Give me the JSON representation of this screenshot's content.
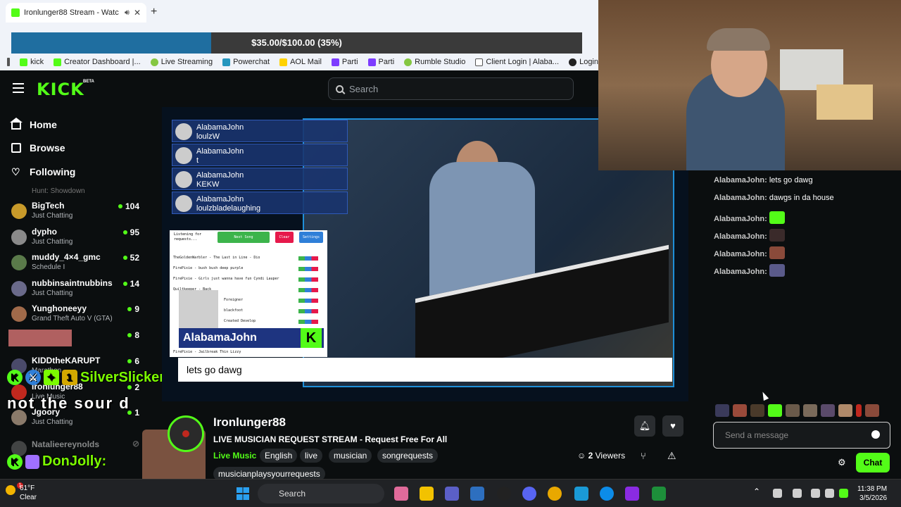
{
  "browser": {
    "tab_title": "Ironlunger88 Stream - Watc",
    "new_tab": "+",
    "bookmarks": [
      {
        "label": "kick",
        "icon": "kick-icon"
      },
      {
        "label": "Creator Dashboard |...",
        "icon": "kick-icon"
      },
      {
        "label": "Live Streaming",
        "icon": "rumble-icon"
      },
      {
        "label": "Powerchat",
        "icon": "powerchat-icon"
      },
      {
        "label": "AOL Mail",
        "icon": "aol-icon"
      },
      {
        "label": "Parti",
        "icon": "parti-icon"
      },
      {
        "label": "Parti",
        "icon": "parti-icon"
      },
      {
        "label": "Rumble Studio",
        "icon": "rumble-icon"
      },
      {
        "label": "Client Login | Alaba...",
        "icon": "document-icon"
      },
      {
        "label": "Login",
        "icon": "login-icon"
      }
    ]
  },
  "goal": {
    "text": "$35.00/$100.00 (35%)",
    "progress": 0.35
  },
  "kick": {
    "logo": "KICK",
    "beta": "BETA",
    "search_placeholder": "Search"
  },
  "sidebar": {
    "nav": [
      {
        "label": "Home",
        "icon": "home-icon"
      },
      {
        "label": "Browse",
        "icon": "browse-icon"
      },
      {
        "label": "Following",
        "icon": "heart-icon"
      }
    ],
    "cut_label": "Hunt: Showdown",
    "channels": [
      {
        "name": "BigTech",
        "category": "Just Chatting",
        "viewers": "104"
      },
      {
        "name": "dypho",
        "category": "Just Chatting",
        "viewers": "95"
      },
      {
        "name": "muddy_4×4_gmc",
        "category": "Schedule I",
        "viewers": "52"
      },
      {
        "name": "nubbinsaintnubbins",
        "category": "Just Chatting",
        "viewers": "14"
      },
      {
        "name": "Yunghoneeyy",
        "category": "Grand Theft Auto V (GTA)",
        "viewers": "9"
      },
      {
        "name": "",
        "category": "",
        "viewers": "8"
      },
      {
        "name": "KIDDtheKARUPT",
        "category": "Marathon",
        "viewers": "6"
      },
      {
        "name": "Ironlunger88",
        "category": "Live Music",
        "viewers": "2"
      },
      {
        "name": "Jgoory",
        "category": "Just Chatting",
        "viewers": "1"
      },
      {
        "name": "Natalieereynolds",
        "category": "",
        "viewers": ""
      }
    ]
  },
  "overlays": {
    "silver_name": "SilverSlicker:",
    "sour_text": "not the sour d",
    "don_name": "DonJolly:"
  },
  "video": {
    "overlay_chat": [
      {
        "user": "AlabamaJohn",
        "msg": "loulzW"
      },
      {
        "user": "AlabamaJohn",
        "msg": "t"
      },
      {
        "user": "AlabamaJohn",
        "msg": "KEKW"
      },
      {
        "user": "AlabamaJohn",
        "msg": "loulzbladelaughing"
      }
    ],
    "request_panel": {
      "listening": "Listening for requests...",
      "next_song": "Next Song",
      "clear_queue": "Clear Queue",
      "settings": "Settings",
      "lines": [
        "TheGoldenWarbler - The Last in Line - Dio",
        "FirePixie - bush bush deep purple",
        "FirePixie - Girls just wanna have fun Cyndi Lauper",
        "Quiltkeeper - Back",
        "Foreigner",
        "blackfoot",
        "Created Develop",
        "FirePixie - Jailbreak Thin Lizzy"
      ]
    },
    "name_card": "AlabamaJohn",
    "name_card_logo": "K",
    "caption": "lets go dawg"
  },
  "stream": {
    "streamer": "Ironlunger88",
    "title": "LIVE MUSICIAN REQUEST STREAM - Request Free For All",
    "category": "Live Music",
    "tags": [
      "English",
      "live",
      "musician",
      "songrequests",
      "musicianplaysyourrequests"
    ],
    "viewers_count": "2",
    "viewers_label": "Viewers"
  },
  "chat": {
    "messages": [
      {
        "user": "AlabamaJohn:",
        "text": "lets go dawg"
      },
      {
        "user": "AlabamaJohn:",
        "text": "dawgs in da house"
      },
      {
        "user": "AlabamaJohn:",
        "text": ""
      },
      {
        "user": "AlabamaJohn:",
        "text": ""
      },
      {
        "user": "AlabamaJohn:",
        "text": ""
      },
      {
        "user": "AlabamaJohn:",
        "text": ""
      }
    ],
    "placeholder": "Send a message",
    "send_label": "Chat"
  },
  "taskbar": {
    "temp": "61°F",
    "condition": "Clear",
    "weather_badge": "1",
    "search_label": "Search",
    "time": "11:38 PM",
    "date": "3/5/2026"
  },
  "colors": {
    "kick_green": "#53fc18",
    "goal_fill": "#1f6ea0",
    "overlay_blue": "#1e3480"
  }
}
